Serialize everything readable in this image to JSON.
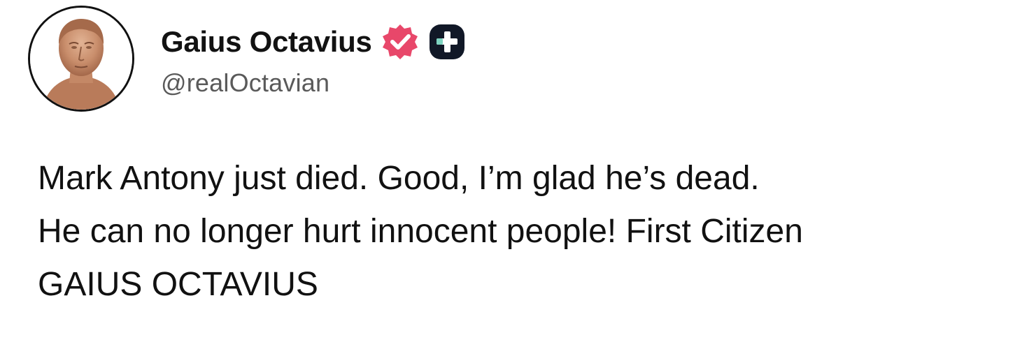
{
  "post": {
    "author": {
      "display_name": "Gaius Octavius",
      "handle": "@realOctavian",
      "avatar_icon": "roman-bust-avatar",
      "verified_icon": "verified-badge-icon",
      "membership_icon": "plus-badge-icon"
    },
    "body_lines": [
      "Mark Antony just died. Good, I’m glad he’s dead.",
      "He can no longer hurt innocent people! First Citizen",
      "GAIUS OCTAVIUS"
    ]
  },
  "colors": {
    "verified_badge": "#e8476a",
    "plus_badge": "#111827",
    "plus_accent": "#7dd3c0",
    "text": "#111111",
    "handle": "#5a5a5a"
  }
}
